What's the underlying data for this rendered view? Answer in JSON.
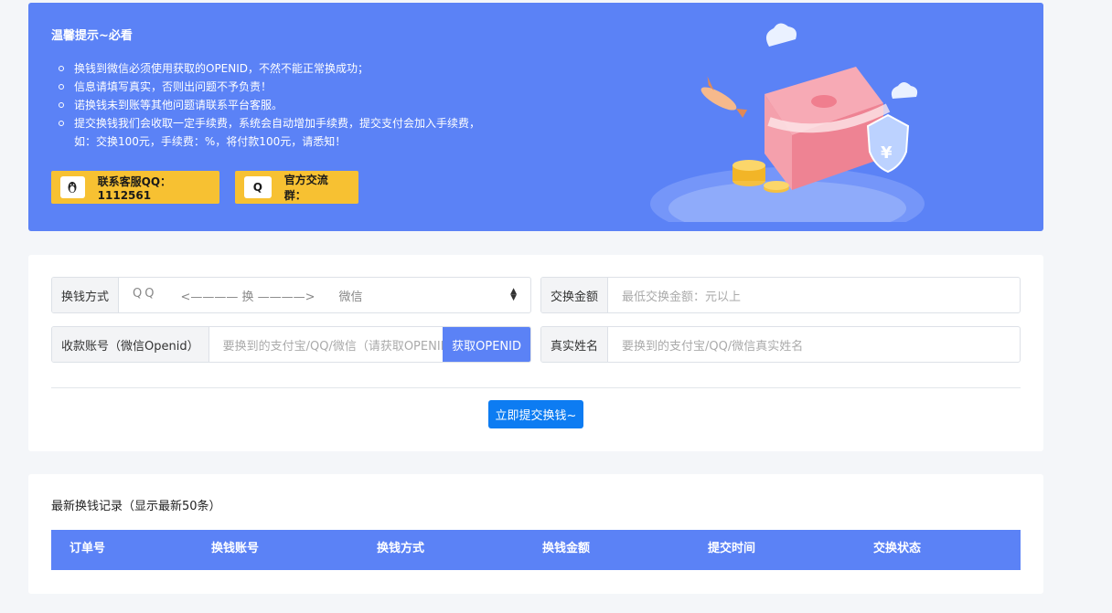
{
  "notice": {
    "title": "温馨提示~必看",
    "items": [
      "换钱到微信必须使用获取的OPENID，不然不能正常换成功；",
      "信息请填写真实，否则出问题不予负责！",
      "诺换钱未到账等其他问题请联系平台客服。",
      "提交换钱我们会收取一定手续费，系统会自动增加手续费，提交支付会加入手续费，",
      "如：交换100元，手续费：%，将付款100元，请悉知！"
    ],
    "qq_button": {
      "icon": "penguin-icon",
      "label": "联系客服QQ：1112561"
    },
    "group_button": {
      "icon_text": "Q",
      "label": "官方交流群："
    }
  },
  "form": {
    "method": {
      "label": "换钱方式",
      "from": "QQ",
      "middle": "<———— 换 ————>",
      "to": "微信"
    },
    "amount": {
      "label": "交换金额",
      "placeholder": "最低交换金额：元以上"
    },
    "account": {
      "label": "收款账号（微信Openid）",
      "placeholder": "要换到的支付宝/QQ/微信（请获取OPENID）",
      "get_button": "获取OPENID"
    },
    "name": {
      "label": "真实姓名",
      "placeholder": "要换到的支付宝/QQ/微信真实姓名"
    },
    "submit": "立即提交换钱~"
  },
  "records": {
    "title": "最新换钱记录（显示最新50条）",
    "columns": [
      "订单号",
      "换钱账号",
      "换钱方式",
      "换钱金额",
      "提交时间",
      "交换状态"
    ]
  },
  "colors": {
    "primary": "#5b82f6",
    "accent": "#f7c132",
    "submit": "#0d7cf2"
  }
}
